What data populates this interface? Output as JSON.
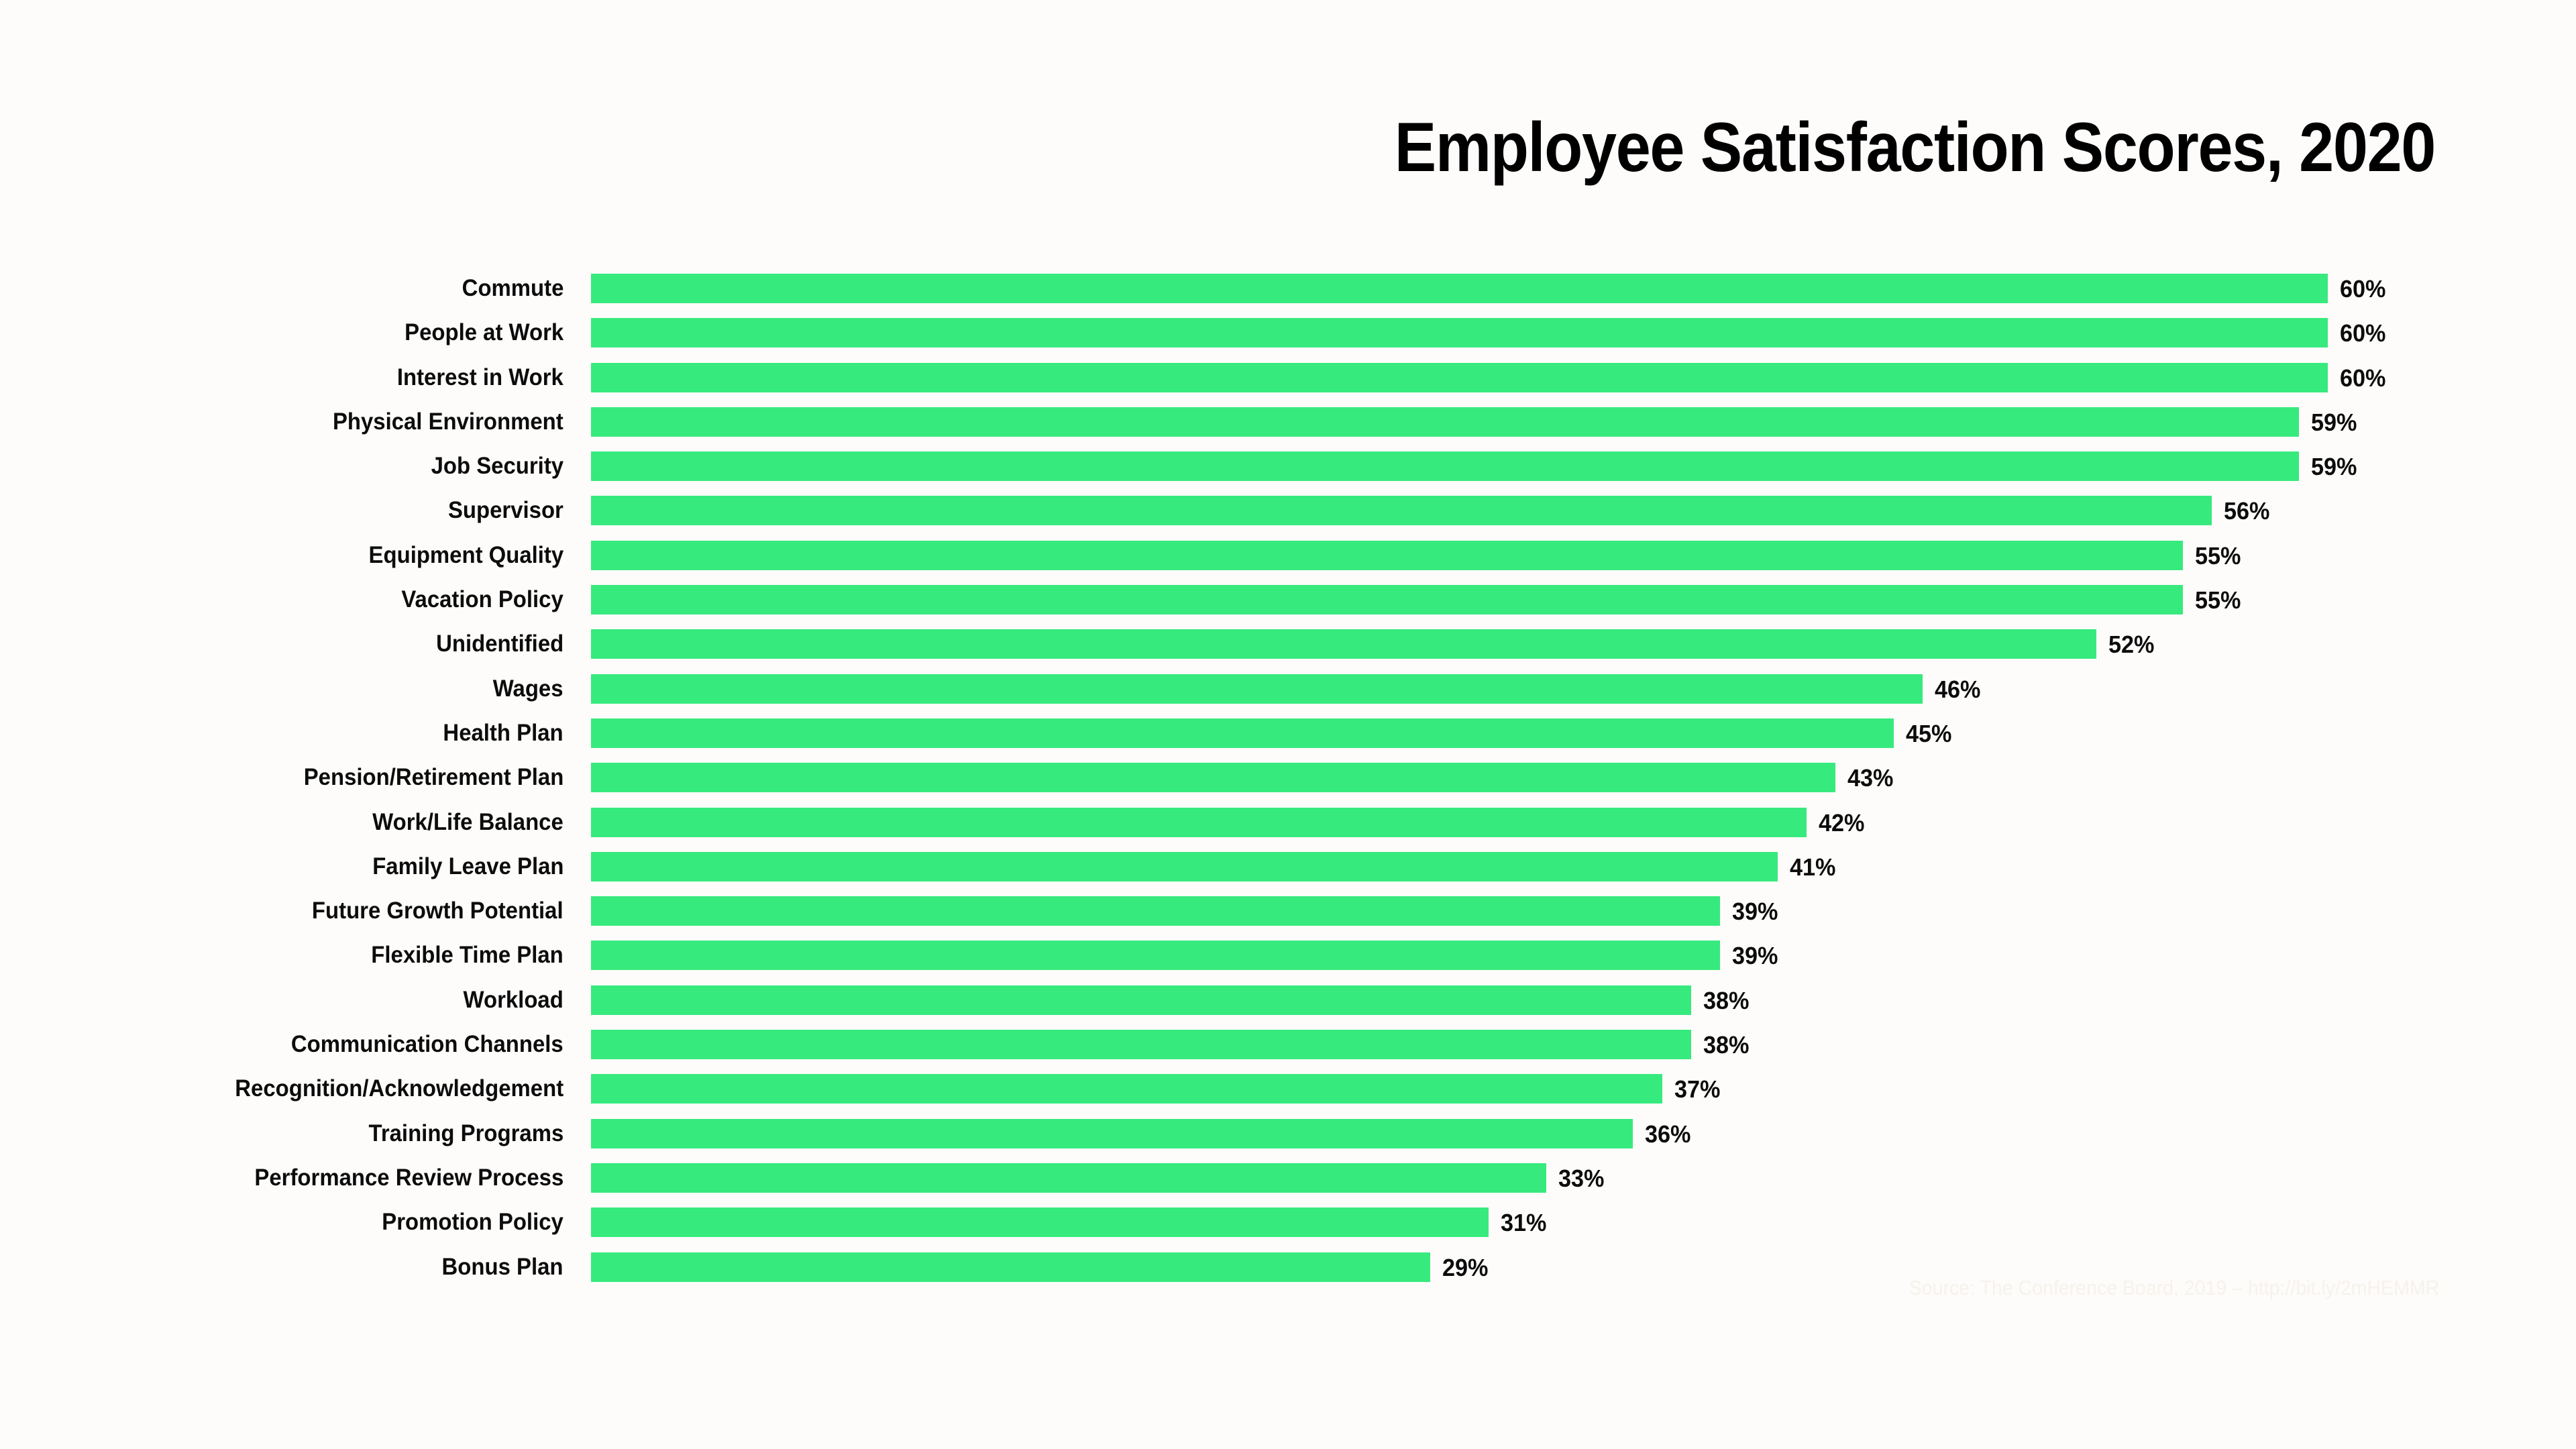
{
  "chart_data": {
    "type": "bar",
    "orientation": "horizontal",
    "title": "Employee Satisfaction Scores, 2020",
    "xlabel": "",
    "ylabel": "",
    "xlim": [
      0,
      60
    ],
    "grid": false,
    "legend": null,
    "value_suffix": "%",
    "bar_color": "#37EA7D",
    "background_color": "#FDFCFA",
    "text_color": "#0C0C0C",
    "source_note": "Source: The Conference Board, 2019 – http://bit.ly/2mHEMMR",
    "categories": [
      "Commute",
      "People at Work",
      "Interest in Work",
      "Physical Environment",
      "Job Security",
      "Supervisor",
      "Equipment Quality",
      "Vacation Policy",
      "Unidentified",
      "Wages",
      "Health Plan",
      "Pension/Retirement Plan",
      "Work/Life Balance",
      "Family Leave Plan",
      "Future Growth Potential",
      "Flexible Time Plan",
      "Workload",
      "Communication Channels",
      "Recognition/Acknowledgement",
      "Training Programs",
      "Performance Review Process",
      "Promotion Policy",
      "Bonus Plan"
    ],
    "values": [
      60,
      60,
      60,
      59,
      59,
      56,
      55,
      55,
      52,
      46,
      45,
      43,
      42,
      41,
      39,
      39,
      38,
      38,
      37,
      36,
      33,
      31,
      29
    ],
    "value_labels": [
      "60%",
      "60%",
      "60%",
      "59%",
      "59%",
      "56%",
      "55%",
      "55%",
      "52%",
      "46%",
      "45%",
      "43%",
      "42%",
      "41%",
      "39%",
      "39%",
      "38%",
      "38%",
      "37%",
      "36%",
      "33%",
      "31%",
      "29%"
    ]
  }
}
